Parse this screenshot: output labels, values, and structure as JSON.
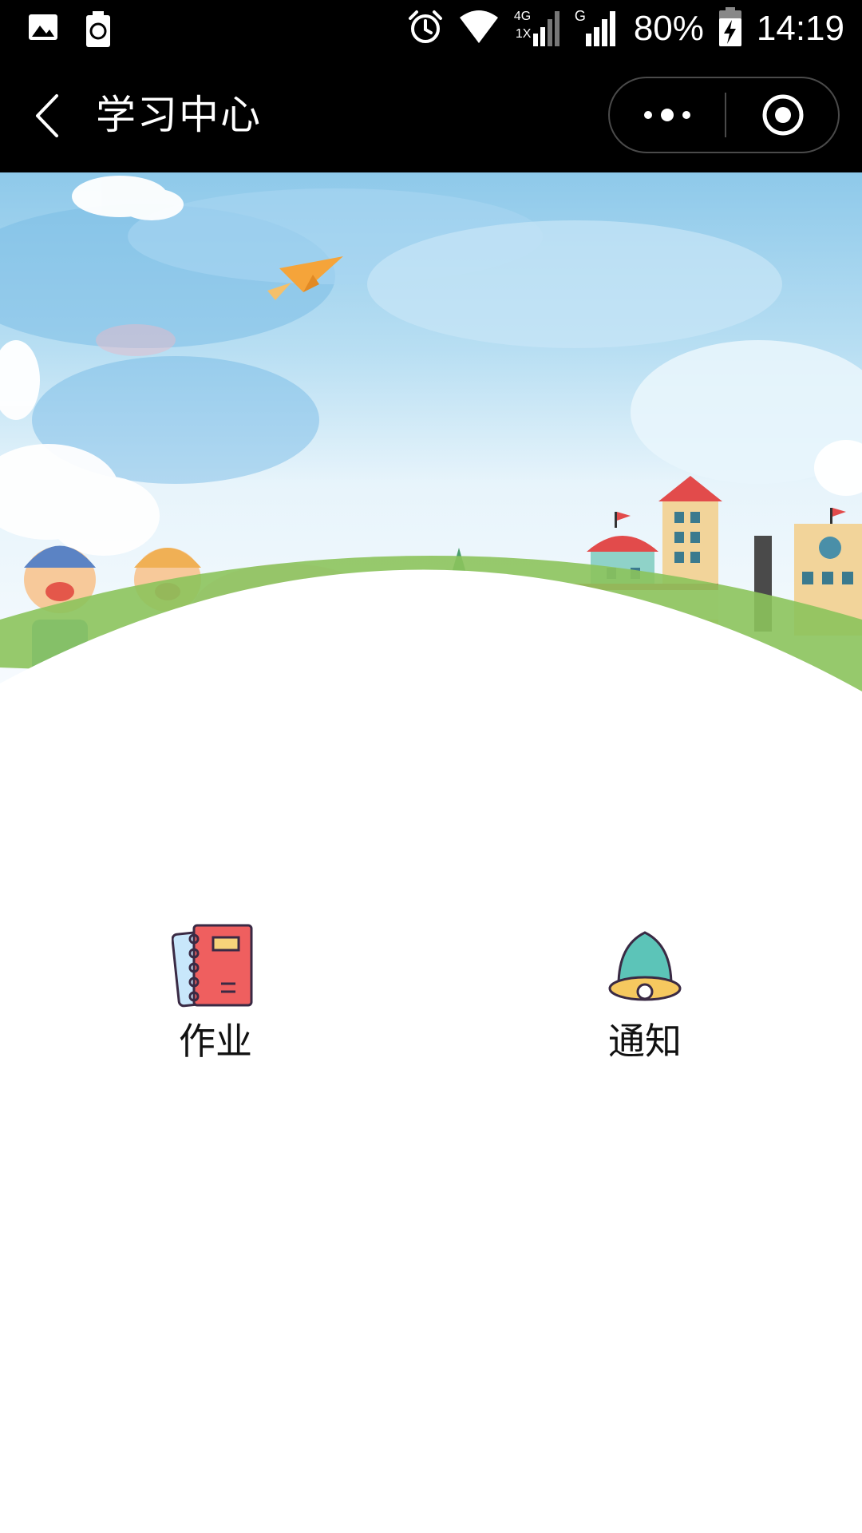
{
  "status_bar": {
    "battery_percent": "80%",
    "time": "14:19",
    "network_label_top": "4G",
    "network_label_bottom": "1X",
    "signal2_label": "G",
    "icons": [
      "image-icon",
      "battery-saver-icon",
      "alarm-icon",
      "wifi-icon",
      "signal-icon",
      "signal-icon",
      "charging-battery-icon"
    ]
  },
  "nav": {
    "title": "学习中心",
    "back_icon": "chevron-left-icon",
    "more_icon": "more-dots-icon",
    "close_icon": "target-close-icon"
  },
  "menu": {
    "items": [
      {
        "label": "作业",
        "icon": "notebook-icon"
      },
      {
        "label": "通知",
        "icon": "bell-icon"
      }
    ]
  },
  "colors": {
    "nav_background": "#000000",
    "notebook_red": "#ef5f5f",
    "bell_teal": "#5cc4b8",
    "bell_yellow": "#f6c85f"
  }
}
